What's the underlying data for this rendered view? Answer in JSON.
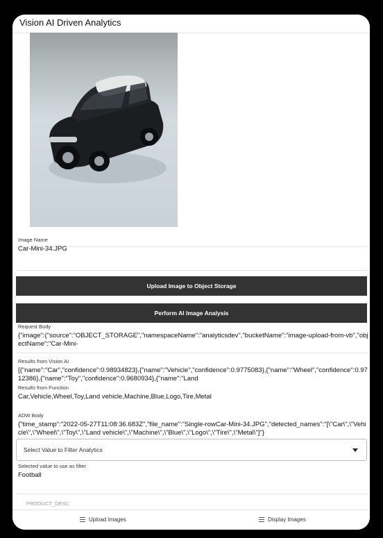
{
  "app": {
    "title": "Vision AI Driven Analytics"
  },
  "image_name": {
    "label": "Image Name",
    "value": "Car-Mini-34.JPG"
  },
  "buttons": {
    "upload": "Upload Image to Object Storage",
    "analyze": "Perform AI Image Analysis"
  },
  "request_body": {
    "label": "Request Body",
    "value": "{\"image\":{\"source\":\"OBJECT_STORAGE\",\"namespaceName\":\"analyticsdev\",\"bucketName\":\"image-upload-from-vb\",\"objectName\":\"Car-Mini-"
  },
  "vision_results": {
    "label": "Results from Vision AI",
    "value": "[{\"name\":\"Car\",\"confidence\":0.98934823},{\"name\":\"Vehicle\",\"confidence\":0.9775083},{\"name\":\"Wheel\",\"confidence\":0.9712386},{\"name\":\"Toy\",\"confidence\":0.9680934},{\"name\":\"Land"
  },
  "function_results": {
    "label": "Results from Function",
    "value": "Car,Vehicle,Wheel,Toy,Land vehicle,Machine,Blue,Logo,Tire,Metal"
  },
  "adw_body": {
    "label": "ADW Body",
    "value": "{\"time_stamp\":\"2022-05-27T11:08:36.683Z\",\"file_name\":\"Single-rowCar-Mini-34.JPG\",\"detected_names\":\"[\\\"Car\\\",\\\"Vehicle\\\",\\\"Wheel\\\",\\\"Toy\\\",\\\"Land vehicle\\\",\\\"Machine\\\",\\\"Blue\\\",\\\"Logo\\\",\\\"Tire\\\",\\\"Metal\\\"]\"}"
  },
  "filter_select": {
    "placeholder": "Select Value to Filter Analytics"
  },
  "selected_value": {
    "label": "Selected value to use as filter",
    "value": "Football"
  },
  "peek_text": "PRODUCT_DESC",
  "nav": {
    "upload": "Upload Images",
    "display": "Display Images"
  },
  "icons": {
    "nav_upload": "list-icon",
    "nav_display": "list-icon",
    "select_arrow": "chevron-down-icon"
  },
  "colors": {
    "button_bg": "#333333",
    "button_text": "#ffffff",
    "background": "#000000"
  }
}
